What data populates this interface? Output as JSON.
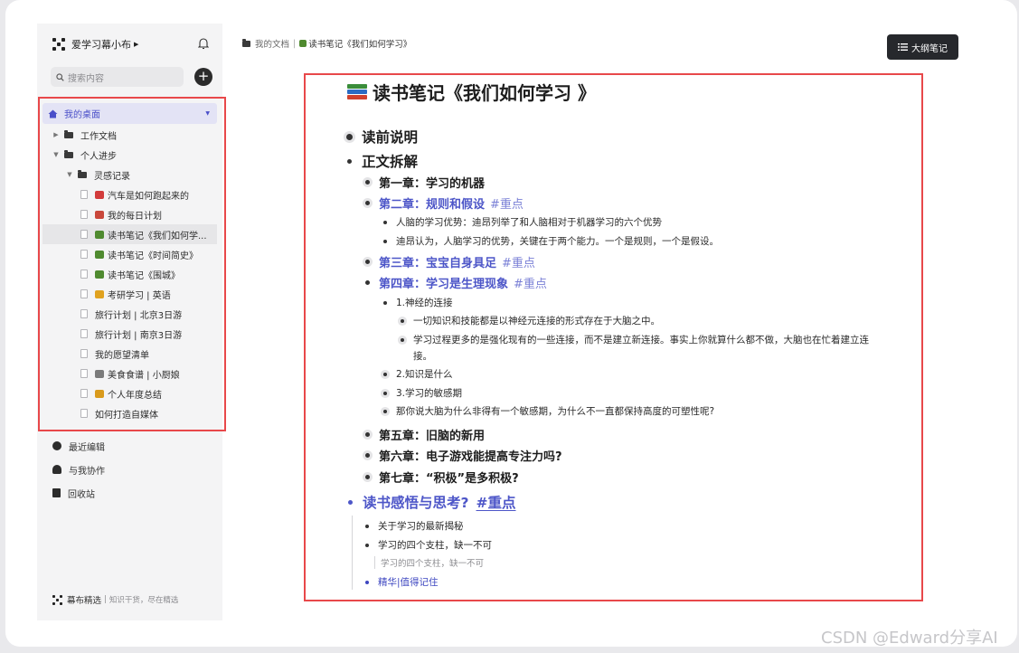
{
  "sidebar": {
    "workspace": "爱学习幕小布",
    "search_placeholder": "搜索内容",
    "add_label": "+",
    "tree": [
      {
        "label": "我的桌面",
        "level": 0,
        "type": "desk",
        "selected": false
      },
      {
        "label": "工作文档",
        "level": 1,
        "type": "folder",
        "expanded": false
      },
      {
        "label": "个人进步",
        "level": 1,
        "type": "folder",
        "expanded": true
      },
      {
        "label": "灵感记录",
        "level": 2,
        "type": "folder",
        "expanded": true
      },
      {
        "label": "汽车是如何跑起来的",
        "level": 3,
        "type": "doc",
        "emoji": "#d23b3b"
      },
      {
        "label": "我的每日计划",
        "level": 3,
        "type": "doc",
        "emoji": "#c9473b"
      },
      {
        "label": "读书笔记《我们如何学...",
        "level": 3,
        "type": "doc",
        "emoji": "#4f8a2f",
        "selected": true
      },
      {
        "label": "读书笔记《时间简史》",
        "level": 3,
        "type": "doc",
        "emoji": "#4f8a2f"
      },
      {
        "label": "读书笔记《围城》",
        "level": 3,
        "type": "doc",
        "emoji": "#4f8a2f"
      },
      {
        "label": "考研学习 | 英语",
        "level": 3,
        "type": "doc",
        "emoji": "#e0a21f"
      },
      {
        "label": "旅行计划 | 北京3日游",
        "level": 3,
        "type": "doc"
      },
      {
        "label": "旅行计划 | 南京3日游",
        "level": 3,
        "type": "doc"
      },
      {
        "label": "我的愿望清单",
        "level": 3,
        "type": "doc"
      },
      {
        "label": "美食食谱 | 小厨娘",
        "level": 3,
        "type": "doc",
        "emoji": "#7a7a7a"
      },
      {
        "label": "个人年度总结",
        "level": 3,
        "type": "doc",
        "emoji": "#d99a1c"
      },
      {
        "label": "如何打造自媒体",
        "level": 3,
        "type": "doc"
      }
    ],
    "nav": [
      {
        "label": "最近编辑",
        "icon": "clock-icon"
      },
      {
        "label": "与我协作",
        "icon": "users-icon"
      },
      {
        "label": "回收站",
        "icon": "trash-icon"
      }
    ],
    "footer": {
      "brand": "幕布精选",
      "slogan": "知识干货，尽在精选"
    }
  },
  "breadcrumb": {
    "root": "我的文档",
    "sep": "|",
    "current": "读书笔记《我们如何学习》"
  },
  "outline_button": "大纲笔记",
  "doc": {
    "title": "读书笔记《我们如何学习 》",
    "intro": "读前说明",
    "main": "正文拆解",
    "ch1": "第一章：学习的机器",
    "ch2": "第二章：规则和假设",
    "tag": "#重点",
    "ch2_p1": "人脑的学习优势：迪昂列举了和人脑相对于机器学习的六个优势",
    "ch2_p2": "迪昂认为，人脑学习的优势，关键在于两个能力。一个是规则，一个是假设。",
    "ch3": "第三章：宝宝自身具足",
    "ch4": "第四章：学习是生理现象",
    "ch4_s1": "1.神经的连接",
    "ch4_s1_a": "一切知识和技能都是以神经元连接的形式存在于大脑之中。",
    "ch4_s1_b": "学习过程更多的是强化现有的一些连接，而不是建立新连接。事实上你就算什么都不做，大脑也在忙着建立连接。",
    "ch4_s2": "2.知识是什么",
    "ch4_s3": "3.学习的敏感期",
    "ch4_s4": "那你说大脑为什么非得有一个敏感期，为什么不一直都保持高度的可塑性呢?",
    "ch5": "第五章：旧脑的新用",
    "ch6": "第六章：电子游戏能提高专注力吗?",
    "ch7": "第七章：“积极”是多积极?",
    "reflect": "读书感悟与思考?",
    "r1": "关于学习的最新揭秘",
    "r2": "学习的四个支柱，缺一不可",
    "r2_note": "学习的四个支柱，缺一不可",
    "r3": "精华|值得记住"
  },
  "watermark": "CSDN @Edward分享AI",
  "colors": {
    "accent": "#4d56c8",
    "highlight_box": "#e8484a"
  }
}
